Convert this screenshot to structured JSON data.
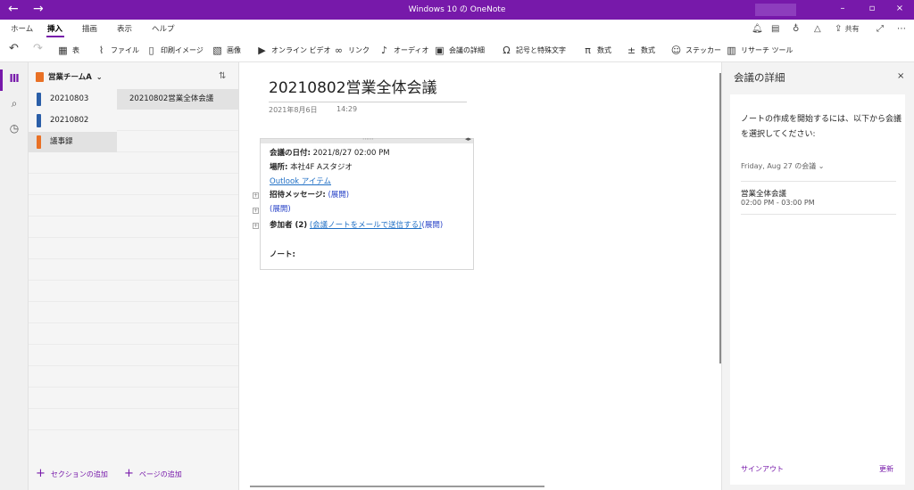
{
  "app": {
    "window_title": "Windows 10 の OneNote",
    "back_glyph": "←",
    "forward_glyph": "→",
    "minimize": "–",
    "maximize": "▫",
    "close": "×"
  },
  "tabs": [
    "ホーム",
    "挿入",
    "描画",
    "表示",
    "ヘルプ"
  ],
  "active_tab": "挿入",
  "right_tools": {
    "share_label": "共有",
    "icons": [
      "bell-icon",
      "sticky-note-icon",
      "lightbulb-icon",
      "notification-icon",
      "share-icon",
      "expand-icon",
      "more-icon"
    ]
  },
  "ribbon": [
    "表",
    "ファイル",
    "印刷イメージ",
    "画像",
    "オンライン ビデオ",
    "リンク",
    "オーディオ",
    "会議の詳細",
    "記号と特殊文字",
    "数式",
    "数式",
    "ステッカー",
    "リサーチ ツール"
  ],
  "notebook": {
    "name": "営業チームA",
    "color": "#e97126"
  },
  "sections": [
    {
      "label": "20210803",
      "color": "#2b5fa8"
    },
    {
      "label": "20210802",
      "color": "#2b5fa8"
    },
    {
      "label": "議事録",
      "color": "#e97126"
    }
  ],
  "selected_section": "議事録",
  "add_section": "セクションの追加",
  "pages": [
    "20210802営業全体会議"
  ],
  "add_page": "ページの追加",
  "page": {
    "title": "20210802営業全体会議",
    "date": "2021年8月6日",
    "time": "14:29",
    "meeting_date_label": "会議の日付:",
    "meeting_date_value": "2021/8/27 02:00 PM",
    "location_label": "場所:",
    "location_value": "本社4F Aスタジオ",
    "outlook_link": "Outlook アイテム",
    "invite_label": "招待メッセージ:",
    "expand": "(展開)",
    "attendees_label": "参加者 (2)",
    "email_link": "(会議ノートをメールで送信する)",
    "notes_label": "ノート:"
  },
  "pane": {
    "title": "会議の詳細",
    "close": "×",
    "description": "ノートの作成を開始するには、以下から会議を選択してください:",
    "date_filter": "Friday, Aug 27 の会議",
    "meeting_title": "営業全体会議",
    "meeting_time": "02:00 PM - 03:00 PM",
    "signout": "サインアウト",
    "refresh": "更新"
  },
  "colors": {
    "brand": "#7719aa",
    "link": "#1f6fc5"
  }
}
